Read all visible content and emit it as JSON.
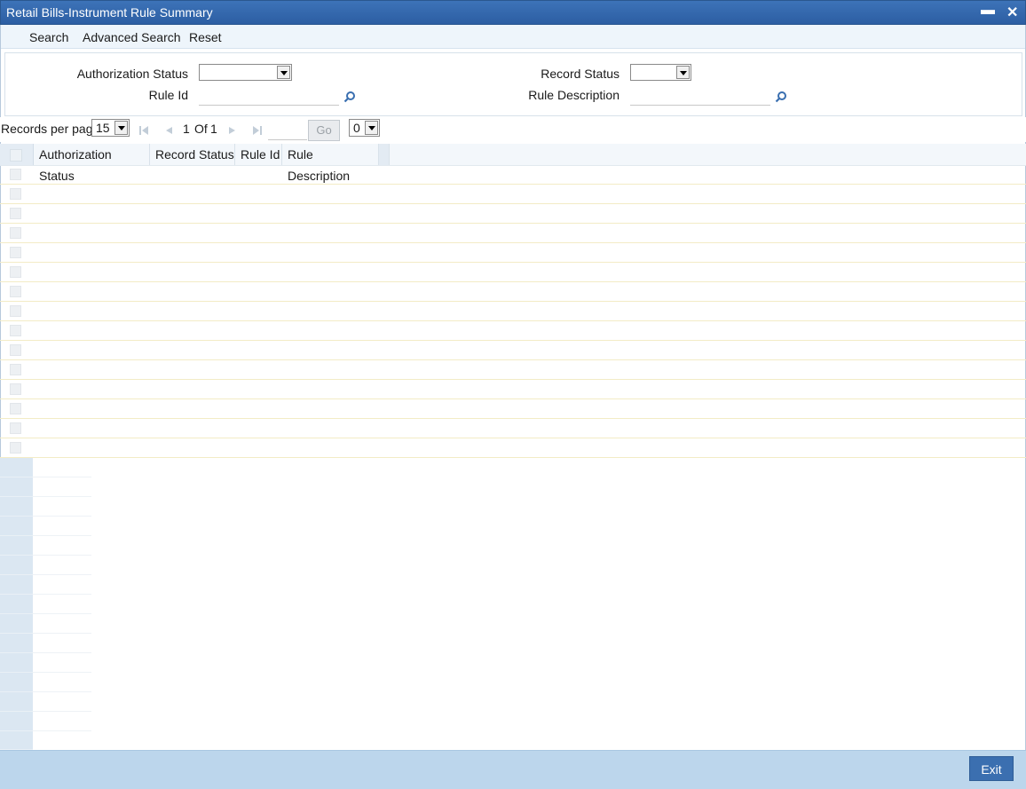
{
  "window": {
    "title": "Retail Bills-Instrument Rule Summary",
    "minimize_label": "▬",
    "close_label": "✕"
  },
  "menu": {
    "search": "Search",
    "advanced_search": "Advanced Search",
    "reset": "Reset"
  },
  "criteria": {
    "authorization_status": {
      "label": "Authorization Status",
      "value": ""
    },
    "record_status": {
      "label": "Record Status",
      "value": ""
    },
    "rule_id": {
      "label": "Rule Id",
      "value": ""
    },
    "rule_description": {
      "label": "Rule Description",
      "value": ""
    }
  },
  "pager": {
    "records_per_page_label": "Records per page",
    "records_per_page_value": "15",
    "page_current": "1",
    "of_label": "Of",
    "page_total": "1",
    "goto_value": "",
    "go_label": "Go",
    "secondary_select_value": "0"
  },
  "grid": {
    "columns": [
      "Authorization Status",
      "Record Status",
      "Rule Id",
      "Rule Description"
    ],
    "rows": []
  },
  "footer": {
    "exit_label": "Exit"
  },
  "colors": {
    "titlebar": "#2c5ea3",
    "footer": "#bcd6ec",
    "exit_button": "#3b6fb0",
    "search_icon": "#3a6fb0"
  },
  "icons": [
    "minimize-icon",
    "close-icon",
    "search-icon",
    "first-page-icon",
    "previous-page-icon",
    "next-page-icon",
    "last-page-icon",
    "dropdown-arrow-icon"
  ]
}
